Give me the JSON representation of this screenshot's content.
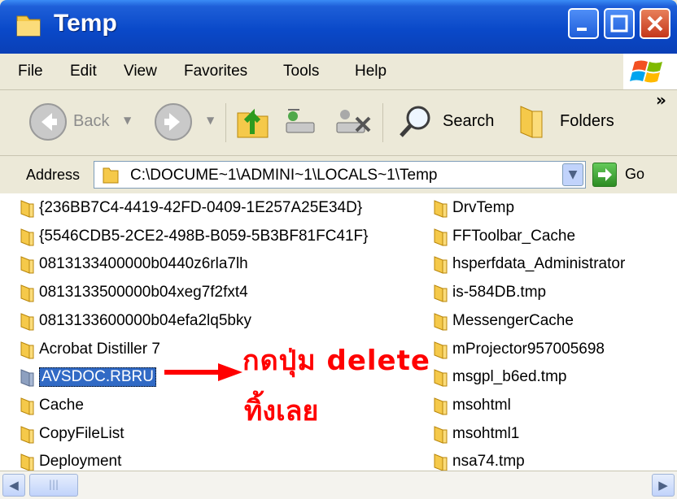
{
  "window": {
    "title": "Temp"
  },
  "menu": [
    "File",
    "Edit",
    "View",
    "Favorites",
    "Tools",
    "Help"
  ],
  "toolbar": {
    "back_label": "Back",
    "search_label": "Search",
    "folders_label": "Folders",
    "overflow_label": "»"
  },
  "address": {
    "label": "Address",
    "path": "C:\\DOCUME~1\\ADMINI~1\\LOCALS~1\\Temp",
    "go_label": "Go"
  },
  "files_left": [
    "{236BB7C4-4419-42FD-0409-1E257A25E34D}",
    "{5546CDB5-2CE2-498B-B059-5B3BF81FC41F}",
    "0813133400000b0440z6rla7lh",
    "0813133500000b04xeg7f2fxt4",
    "0813133600000b04efa2lq5bky",
    "Acrobat Distiller 7",
    "AVSDOC.RBRU",
    "Cache",
    "CopyFileList",
    "Deployment"
  ],
  "files_right": [
    "DrvTemp",
    "FFToolbar_Cache",
    "hsperfdata_Administrator",
    "is-584DB.tmp",
    "MessengerCache",
    "mProjector957005698",
    "msgpl_b6ed.tmp",
    "msohtml",
    "msohtml1",
    "nsa74.tmp"
  ],
  "selected_file": "AVSDOC.RBRU",
  "annotation": {
    "line1": "กดปุ่ม delete",
    "line2": "ทิ้งเลย",
    "color": "#ff0000"
  },
  "colors": {
    "titlebar": "#0a49c9",
    "selection": "#316ac5",
    "folder": "#f5c94a"
  }
}
